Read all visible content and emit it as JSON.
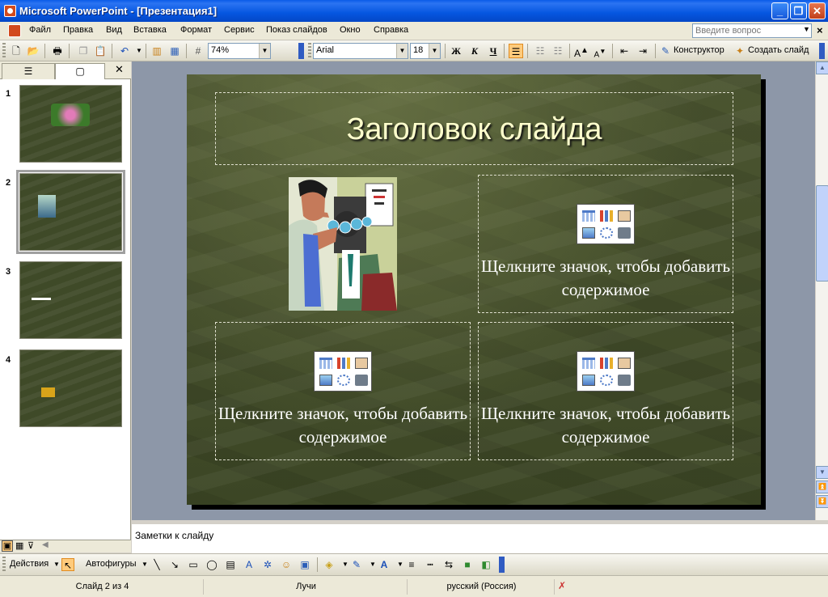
{
  "window": {
    "title": "Microsoft PowerPoint - [Презентация1]"
  },
  "menu": {
    "items": [
      "Файл",
      "Правка",
      "Вид",
      "Вставка",
      "Формат",
      "Сервис",
      "Показ слайдов",
      "Окно",
      "Справка"
    ],
    "help_placeholder": "Введите вопрос"
  },
  "toolbar": {
    "zoom": "74%",
    "font": "Arial",
    "font_size": "18",
    "bold": "Ж",
    "italic": "К",
    "underline": "Ч",
    "designer": "Конструктор",
    "new_slide": "Создать слайд"
  },
  "slide": {
    "title": "Заголовок слайда",
    "content_prompt": "Щелкните значок, чтобы добавить содержимое"
  },
  "thumbnails": [
    {
      "number": "1"
    },
    {
      "number": "2",
      "selected": true
    },
    {
      "number": "3"
    },
    {
      "number": "4"
    }
  ],
  "notes": {
    "placeholder": "Заметки к слайду"
  },
  "drawing": {
    "actions": "Действия",
    "autoshapes": "Автофигуры"
  },
  "status": {
    "slide": "Слайд 2 из 4",
    "design": "Лучи",
    "language": "русский (Россия)"
  },
  "colors": {
    "titlebar": "#0556E0",
    "slide_bg": "#4A5530",
    "title_text": "#FFFFCC"
  }
}
